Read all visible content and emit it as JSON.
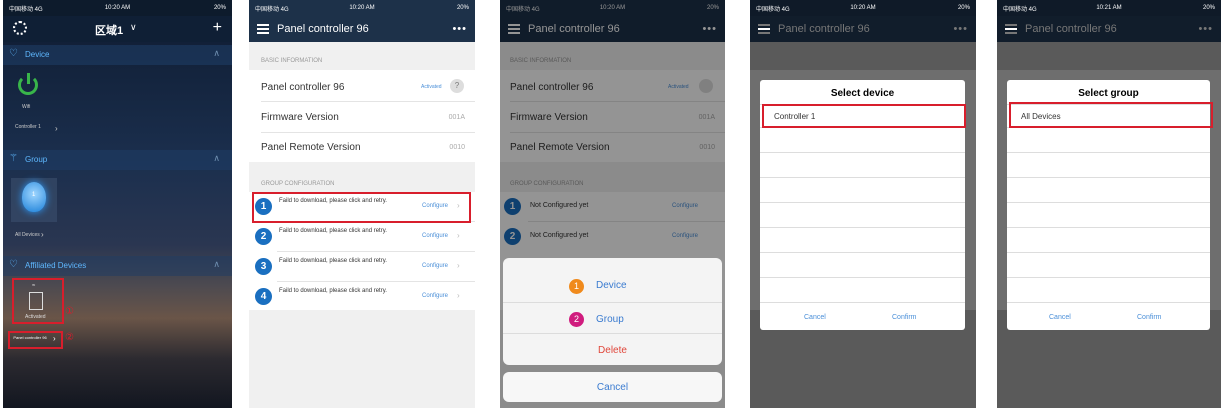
{
  "status": {
    "carrier": "中国移动 4G",
    "time": "10:20 AM",
    "time_alt": "10:21 AM",
    "battery": "20%"
  },
  "screen1": {
    "title": "区域1",
    "device_section": "Device",
    "device_status": "Wifi",
    "device_name": "Controller 1",
    "group_section": "Group",
    "group_icon_label": "1",
    "group_name": "All Devices",
    "affiliated_section": "Affiliated Devices",
    "affiliated_status": "Activated",
    "panel_name": "Panel controller 96",
    "marker1": "①",
    "marker2": "②"
  },
  "screen2": {
    "nav_title": "Panel controller 96",
    "basic_header": "BASIC INFORMATION",
    "panel_row": "Panel controller 96",
    "panel_status": "Activated",
    "help": "?",
    "firmware_label": "Firmware Version",
    "firmware_value": "001A",
    "remote_label": "Panel Remote Version",
    "remote_value": "0010",
    "group_header": "GROUP CONFIGURATION",
    "rows": [
      {
        "num": "1",
        "text": "Faild to download, please click and retry.",
        "action": "Configure"
      },
      {
        "num": "2",
        "text": "Faild to download, please click and retry.",
        "action": "Configure"
      },
      {
        "num": "3",
        "text": "Faild to download, please click and retry.",
        "action": "Configure"
      },
      {
        "num": "4",
        "text": "Faild to download, please click and retry.",
        "action": "Configure"
      }
    ]
  },
  "screen3": {
    "nav_title": "Panel controller 96",
    "basic_header": "BASIC INFORMATION",
    "panel_row": "Panel controller 96",
    "panel_status": "Activated",
    "firmware_label": "Firmware Version",
    "firmware_value": "001A",
    "remote_label": "Panel Remote Version",
    "remote_value": "0010",
    "group_header": "GROUP CONFIGURATION",
    "row1": "Not Configured yet",
    "row2": "Not Configured yet",
    "action": "Configure",
    "sheet_device": "Device",
    "sheet_group": "Group",
    "sheet_delete": "Delete",
    "sheet_cancel": "Cancel",
    "badge1": "1",
    "badge2": "2"
  },
  "screen4": {
    "nav_title": "Panel controller 96",
    "dialog_title": "Select device",
    "option": "Controller 1",
    "cancel": "Cancel",
    "confirm": "Confirm"
  },
  "screen5": {
    "nav_title": "Panel controller 96",
    "dialog_title": "Select group",
    "option": "All Devices",
    "cancel": "Cancel",
    "confirm": "Confirm"
  },
  "colors": {
    "nav": "#1d3149",
    "accent_blue": "#1a6fc0",
    "highlight_red": "#d81e2c",
    "badge_orange": "#f08a1c",
    "badge_magenta": "#d01c7e",
    "power_green": "#39b54a"
  }
}
